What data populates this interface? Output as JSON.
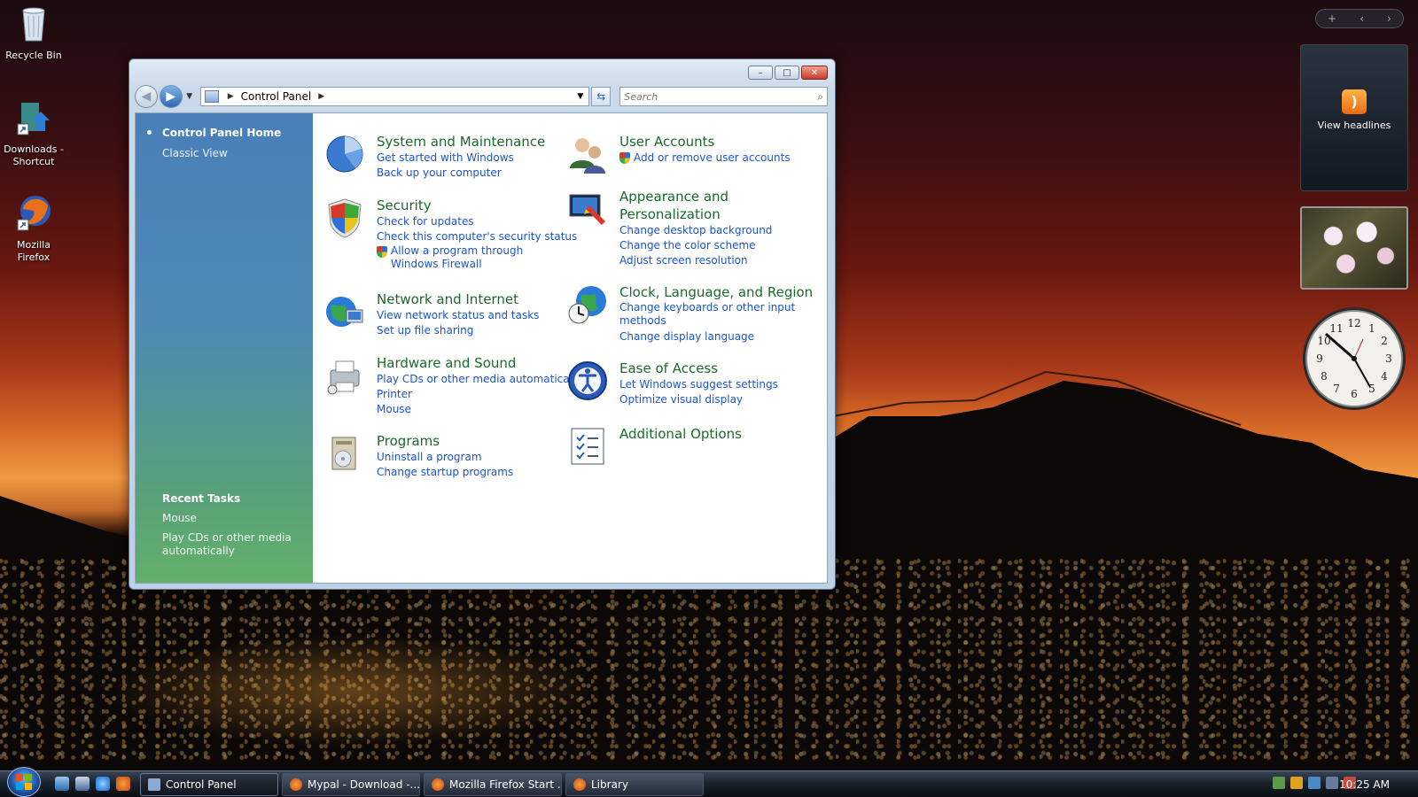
{
  "desktop": {
    "icons": [
      {
        "label": "Recycle Bin"
      },
      {
        "label": "Downloads - Shortcut"
      },
      {
        "label": "Mozilla Firefox"
      }
    ]
  },
  "window": {
    "title_buttons": {
      "minimize": "–",
      "maximize": "□",
      "close": "✕"
    },
    "address": {
      "crumb": "Control Panel"
    },
    "search": {
      "placeholder": "Search"
    },
    "sidebar": {
      "home": "Control Panel Home",
      "classic": "Classic View",
      "recent_title": "Recent Tasks",
      "recent": [
        "Mouse",
        "Play CDs or other media automatically"
      ]
    },
    "categories": [
      {
        "title": "System and Maintenance",
        "links": [
          "Get started with Windows",
          "Back up your computer"
        ]
      },
      {
        "title": "Security",
        "links": [
          "Check for updates",
          "Check this computer's security status",
          "Allow a program through Windows Firewall"
        ]
      },
      {
        "title": "Network and Internet",
        "links": [
          "View network status and tasks",
          "Set up file sharing"
        ]
      },
      {
        "title": "Hardware and Sound",
        "links": [
          "Play CDs or other media automatically",
          "Printer",
          "Mouse"
        ]
      },
      {
        "title": "Programs",
        "links": [
          "Uninstall a program",
          "Change startup programs"
        ]
      },
      {
        "title": "User Accounts",
        "links": [
          "Add or remove user accounts"
        ]
      },
      {
        "title": "Appearance and Personalization",
        "links": [
          "Change desktop background",
          "Change the color scheme",
          "Adjust screen resolution"
        ]
      },
      {
        "title": "Clock, Language, and Region",
        "links": [
          "Change keyboards or other input methods",
          "Change display language"
        ]
      },
      {
        "title": "Ease of Access",
        "links": [
          "Let Windows suggest settings",
          "Optimize visual display"
        ]
      },
      {
        "title": "Additional Options",
        "links": []
      }
    ]
  },
  "gadgets": {
    "feed_label": "View headlines",
    "gadget_bar": {
      "add": "+",
      "prev": "‹",
      "next": "›"
    }
  },
  "taskbar": {
    "tasks": [
      "Control Panel",
      "Mypal - Download -...",
      "Mozilla Firefox Start ...",
      "Library"
    ],
    "time": "10:25 AM"
  },
  "colors": {
    "category_title": "#1a6a2a",
    "link": "#1c55c8",
    "sidebar_top": "#4a7fb8",
    "sidebar_bottom": "#62b06a"
  }
}
